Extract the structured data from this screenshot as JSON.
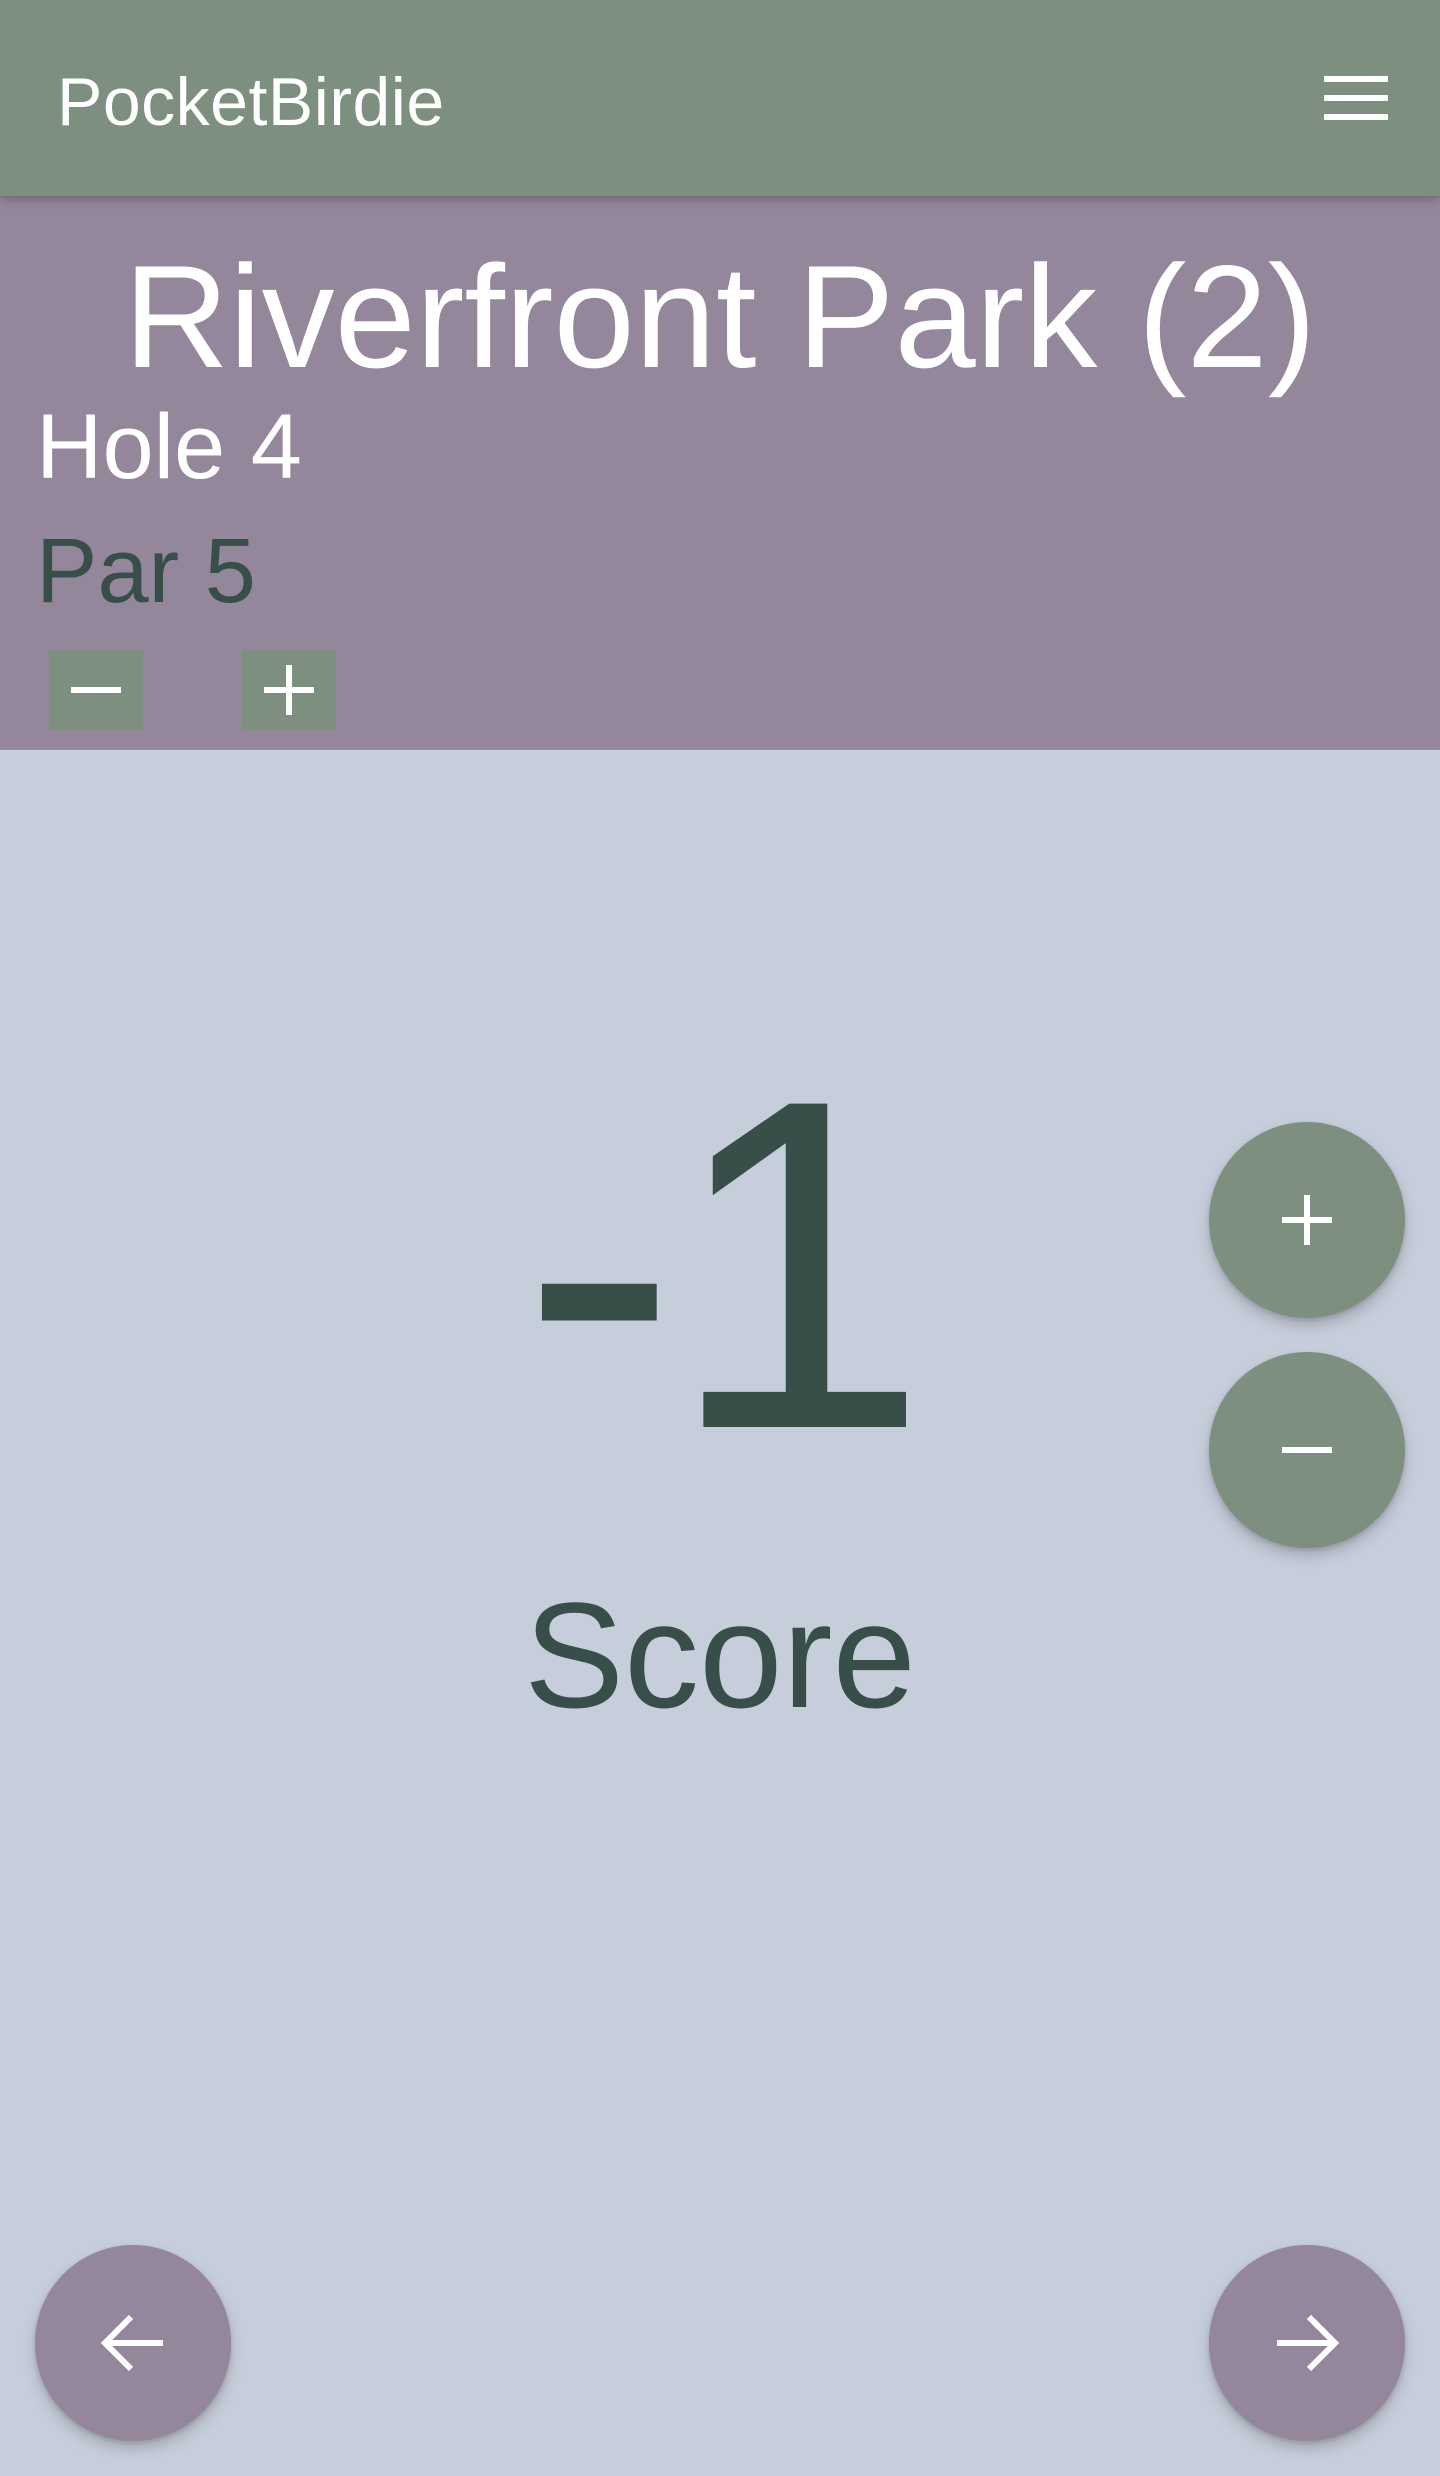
{
  "app": {
    "title": "PocketBirdie",
    "menu_icon": "hamburger-menu-icon"
  },
  "course": {
    "name": "Riverfront Park (2)",
    "hole_label": "Hole 4",
    "par_label": "Par 5",
    "par_decrease_icon": "minus-icon",
    "par_increase_icon": "plus-icon"
  },
  "score": {
    "value": "-1",
    "label": "Score",
    "increase_icon": "plus-icon",
    "decrease_icon": "minus-icon"
  },
  "navigation": {
    "prev_icon": "arrow-left-icon",
    "next_icon": "arrow-right-icon"
  },
  "colors": {
    "appbar": "#7d907f",
    "header_panel": "#94869b",
    "background": "#c7cedb",
    "dark_text": "#374e49",
    "accent_green": "#7d907f",
    "accent_purple": "#94869b"
  }
}
